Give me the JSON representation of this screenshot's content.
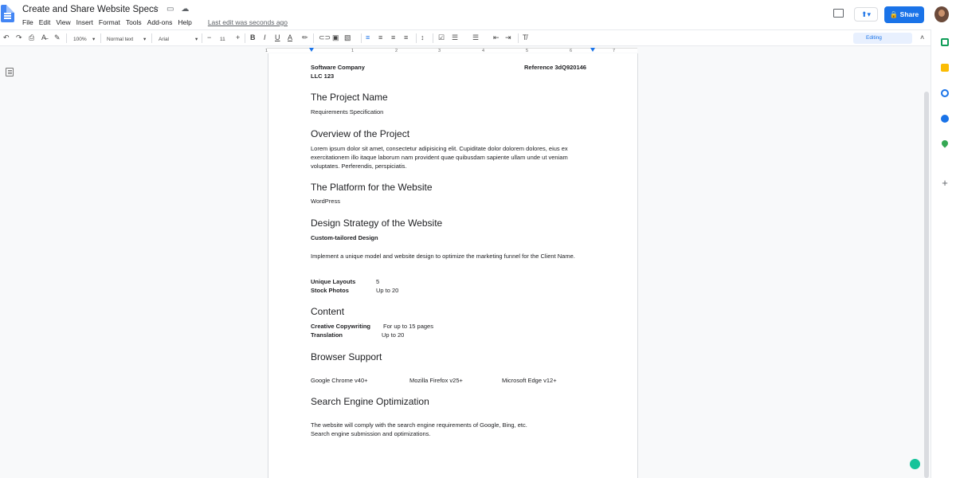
{
  "header": {
    "doc_title": "Create and Share Website Specs",
    "menu": [
      "File",
      "Edit",
      "View",
      "Insert",
      "Format",
      "Tools",
      "Add-ons",
      "Help"
    ],
    "last_edit": "Last edit was seconds ago",
    "share_label": "Share"
  },
  "toolbar": {
    "zoom": "100%",
    "style": "Normal text",
    "font": "Arial",
    "font_size": "11",
    "mode": "Editing"
  },
  "ruler": {
    "marks": [
      "1",
      "1",
      "2",
      "3",
      "4",
      "5",
      "6",
      "7"
    ]
  },
  "document": {
    "company": "Software Company",
    "company2": "LLC 123",
    "reference": "Reference 3dQ920146",
    "h_project": "The Project Name",
    "req_spec": "Requirements Specification",
    "h_overview": "Overview of the Project",
    "overview_text": "Lorem ipsum dolor sit amet, consectetur adipisicing elit. Cupiditate dolor dolorem dolores, eius ex exercitationem illo itaque laborum nam provident quae quibusdam sapiente ullam unde ut veniam voluptates. Perferendis, perspiciatis.",
    "h_platform": "The Platform for the Website",
    "platform": "WordPress",
    "h_design": "Design Strategy of the Website",
    "design_sub": "Custom-tailored Design",
    "design_text": "Implement a unique model and website design to optimize the marketing funnel for the Client Name.",
    "layouts_label": "Unique Layouts",
    "layouts_value": "5",
    "photos_label": "Stock Photos",
    "photos_value": "Up to 20",
    "h_content": "Content",
    "copy_label": "Creative Copywriting",
    "copy_value": "For up to 15 pages",
    "trans_label": "Translation",
    "trans_value": "Up to 20",
    "h_browser": "Browser Support",
    "browser1": "Google Chrome v40+",
    "browser2": "Mozilla Firefox v25+",
    "browser3": "Microsoft Edge v12+",
    "h_seo": "Search Engine Optimization",
    "seo_line1": "The website will comply with the search engine requirements of Google, Bing, etc.",
    "seo_line2": "Search engine submission and optimizations."
  }
}
